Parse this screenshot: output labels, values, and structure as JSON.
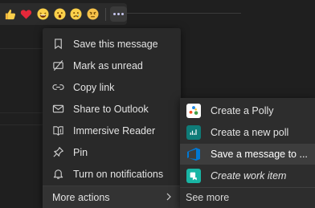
{
  "reactions": [
    {
      "icon": "thumbs-up-icon"
    },
    {
      "icon": "heart-icon"
    },
    {
      "icon": "laughing-face-icon"
    },
    {
      "icon": "surprised-face-icon"
    },
    {
      "icon": "sad-face-icon"
    },
    {
      "icon": "angry-face-icon"
    }
  ],
  "more_options_icon": "more-options-icon",
  "menu": {
    "items": [
      {
        "label": "Save this message",
        "icon": "bookmark-icon"
      },
      {
        "label": "Mark as unread",
        "icon": "mark-unread-icon"
      },
      {
        "label": "Copy link",
        "icon": "link-icon"
      },
      {
        "label": "Share to Outlook",
        "icon": "mail-icon"
      },
      {
        "label": "Immersive Reader",
        "icon": "immersive-reader-icon"
      },
      {
        "label": "Pin",
        "icon": "pin-icon"
      },
      {
        "label": "Turn on notifications",
        "icon": "bell-icon"
      }
    ],
    "more_actions": {
      "label": "More actions",
      "icon": "chevron-right-icon"
    }
  },
  "submenu": {
    "items": [
      {
        "label": "Create a Polly",
        "icon": "polly-app-icon"
      },
      {
        "label": "Create a new poll",
        "icon": "forms-poll-app-icon"
      },
      {
        "label": "Save a message to ...",
        "icon": "azure-devops-app-icon"
      },
      {
        "label": "Create work item",
        "icon": "work-item-app-icon"
      }
    ],
    "see_more": "See more"
  },
  "colors": {
    "menu_bg": "#292929",
    "submenu_bg": "#2d2d2d",
    "highlight": "#3d3d3d",
    "azure_blue": "#0078d4",
    "teal": "#0f7c78"
  }
}
